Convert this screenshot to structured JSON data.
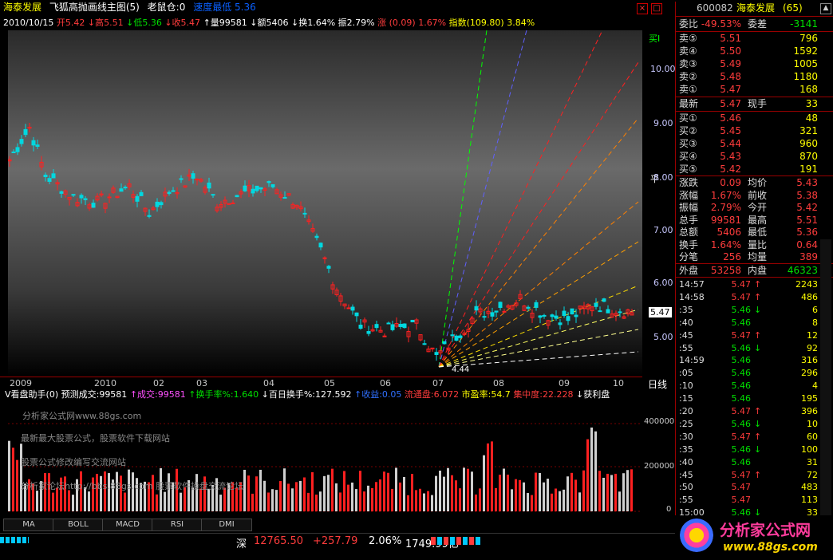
{
  "header": {
    "stock_name": "海泰发展",
    "chart_title": "飞狐高抛画线主图(5)",
    "holding": "老鼠仓:0",
    "extra": "速度最低 5.36",
    "date": "2010/10/15",
    "open": "开5.42",
    "high": "↓高5.51",
    "low": "↓低5.36",
    "close": "↓收5.47",
    "volume": "↑量99581",
    "amount": "↓额5406",
    "turnover": "↓换1.64%",
    "amplitude": "振2.79%",
    "change": "涨 (0.09) 1.67%",
    "index": "指数(109.80) 3.84%"
  },
  "right_axis": {
    "top_label": "买I",
    "labels": [
      "10.00",
      "9.00",
      "8.00",
      "7.00",
      "6.00",
      "5.00"
    ],
    "current_price": "5.47",
    "flat_label": "平"
  },
  "date_axis": [
    "2009",
    "2010",
    "02",
    "03",
    "04",
    "05",
    "06",
    "07",
    "08",
    "09",
    "10"
  ],
  "date_axis_end": "日线",
  "chart_annotations": {
    "low_price": "4.44"
  },
  "indicator": {
    "name": "V看盘助手(0)",
    "predict_vol": "预测成交:99581",
    "vol": "↑成交:99581",
    "turnover_rate": "↑换手率%:1.640",
    "hundred_day": "↓百日换手%:127.592",
    "shou": "↑收益:0.05",
    "float": "流通盘:6.072",
    "pe": "市盈率:54.7",
    "concentration": "集中度:22.228",
    "profit": "↓获利盘",
    "watermarks": [
      "分析家公式网www.88gs.com",
      "最新最大股票公式，股票软件下载网站",
      "股票公式修改编写交流网站",
      "分析家论坛http://bbs.88gs.com 股票软件操盘交流论坛"
    ],
    "axis": [
      "400000",
      "200000",
      "0"
    ]
  },
  "tabs": [
    "MA",
    "BOLL",
    "MACD",
    "RSI",
    "DMI"
  ],
  "status": {
    "market": "深",
    "value": "12765.50",
    "change": "+257.79",
    "pct": "2.06%",
    "amount": "1749.99亿"
  },
  "panel": {
    "code": "600082",
    "name": "海泰发展",
    "count": "(65)",
    "ratio_label": "委比",
    "ratio": "-49.53%",
    "diff_label": "委差",
    "diff": "-3141",
    "sells": [
      {
        "label": "卖⑤",
        "price": "5.51",
        "vol": "796"
      },
      {
        "label": "卖④",
        "price": "5.50",
        "vol": "1592"
      },
      {
        "label": "卖③",
        "price": "5.49",
        "vol": "1005"
      },
      {
        "label": "卖②",
        "price": "5.48",
        "vol": "1180"
      },
      {
        "label": "卖①",
        "price": "5.47",
        "vol": "168"
      }
    ],
    "latest_label": "最新",
    "latest": "5.47",
    "now_label": "现手",
    "now": "33",
    "buys": [
      {
        "label": "买①",
        "price": "5.46",
        "vol": "48"
      },
      {
        "label": "买②",
        "price": "5.45",
        "vol": "321"
      },
      {
        "label": "买③",
        "price": "5.44",
        "vol": "960"
      },
      {
        "label": "买④",
        "price": "5.43",
        "vol": "870"
      },
      {
        "label": "买⑤",
        "price": "5.42",
        "vol": "191"
      }
    ],
    "stats": [
      {
        "l1": "涨跌",
        "v1": "0.09",
        "l2": "均价",
        "v2": "5.43"
      },
      {
        "l1": "涨幅",
        "v1": "1.67%",
        "l2": "前收",
        "v2": "5.38"
      },
      {
        "l1": "振幅",
        "v1": "2.79%",
        "l2": "今开",
        "v2": "5.42"
      },
      {
        "l1": "总手",
        "v1": "99581",
        "l2": "最高",
        "v2": "5.51"
      },
      {
        "l1": "总额",
        "v1": "5406",
        "l2": "最低",
        "v2": "5.36"
      },
      {
        "l1": "换手",
        "v1": "1.64%",
        "l2": "量比",
        "v2": "0.64"
      },
      {
        "l1": "分笔",
        "v1": "256",
        "l2": "均量",
        "v2": "389"
      }
    ],
    "outer_label": "外盘",
    "outer": "53258",
    "inner_label": "内盘",
    "inner": "46323",
    "ticks": [
      {
        "t": "14:57",
        "p": "5.47",
        "a": "↑",
        "v": "2243",
        "c": "red"
      },
      {
        "t": "14:58",
        "p": "5.47",
        "a": "↑",
        "v": "486",
        "c": "red"
      },
      {
        "t": ":35",
        "p": "5.46",
        "a": "↓",
        "v": "6",
        "c": "grn"
      },
      {
        "t": ":40",
        "p": "5.46",
        "a": "",
        "v": "8",
        "c": "grn"
      },
      {
        "t": ":45",
        "p": "5.47",
        "a": "↑",
        "v": "12",
        "c": "red"
      },
      {
        "t": ":55",
        "p": "5.46",
        "a": "↓",
        "v": "92",
        "c": "grn"
      },
      {
        "t": "14:59",
        "p": "5.46",
        "a": "",
        "v": "316",
        "c": "grn"
      },
      {
        "t": ":05",
        "p": "5.46",
        "a": "",
        "v": "296",
        "c": "grn"
      },
      {
        "t": ":10",
        "p": "5.46",
        "a": "",
        "v": "4",
        "c": "grn"
      },
      {
        "t": ":15",
        "p": "5.46",
        "a": "",
        "v": "195",
        "c": "grn"
      },
      {
        "t": ":20",
        "p": "5.47",
        "a": "↑",
        "v": "396",
        "c": "red"
      },
      {
        "t": ":25",
        "p": "5.46",
        "a": "↓",
        "v": "10",
        "c": "grn"
      },
      {
        "t": ":30",
        "p": "5.47",
        "a": "↑",
        "v": "60",
        "c": "red"
      },
      {
        "t": ":35",
        "p": "5.46",
        "a": "↓",
        "v": "100",
        "c": "grn"
      },
      {
        "t": ":40",
        "p": "5.46",
        "a": "",
        "v": "31",
        "c": "grn"
      },
      {
        "t": ":45",
        "p": "5.47",
        "a": "↑",
        "v": "72",
        "c": "red"
      },
      {
        "t": ":50",
        "p": "5.47",
        "a": "",
        "v": "483",
        "c": "red"
      },
      {
        "t": ":55",
        "p": "5.47",
        "a": "",
        "v": "113",
        "c": "red"
      },
      {
        "t": "15:00",
        "p": "5.46",
        "a": "↓",
        "v": "33",
        "c": "grn"
      }
    ]
  },
  "logo": {
    "text": "分析家公式网",
    "url": "www.88gs.com"
  }
}
